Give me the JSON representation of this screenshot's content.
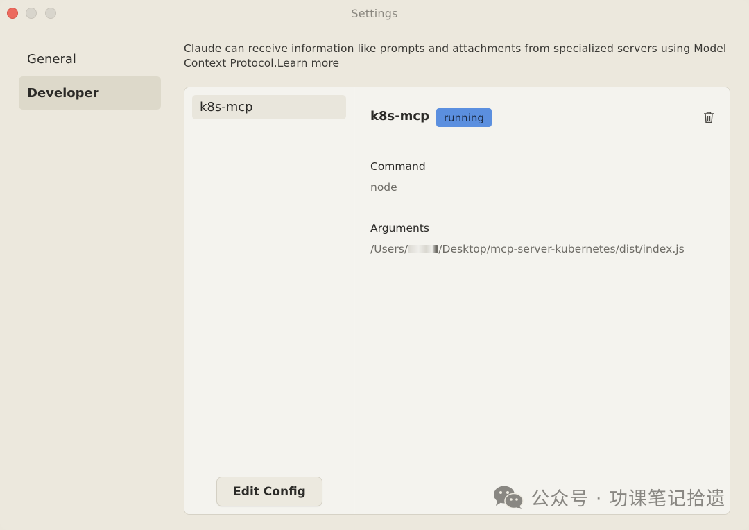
{
  "window": {
    "title": "Settings",
    "buttons": [
      "close",
      "minimize",
      "maximize"
    ]
  },
  "sidebar": {
    "items": [
      {
        "label": "General",
        "selected": false
      },
      {
        "label": "Developer",
        "selected": true
      }
    ]
  },
  "main": {
    "description": "Claude can receive information like prompts and attachments from specialized servers using Model Context Protocol.Learn more",
    "servers": [
      {
        "name": "k8s-mcp",
        "selected": true
      }
    ],
    "edit_config_label": "Edit Config",
    "detail": {
      "name": "k8s-mcp",
      "status": "running",
      "status_color": "#5b8fdf",
      "command_label": "Command",
      "command_value": "node",
      "arguments_label": "Arguments",
      "arguments_prefix": "/Users/",
      "arguments_suffix": "/Desktop/mcp-server-kubernetes/dist/index.js"
    },
    "delete_icon": "trash-icon"
  },
  "watermark": {
    "icon": "wechat-icon",
    "text": "公众号 · 功课笔记拾遗"
  }
}
